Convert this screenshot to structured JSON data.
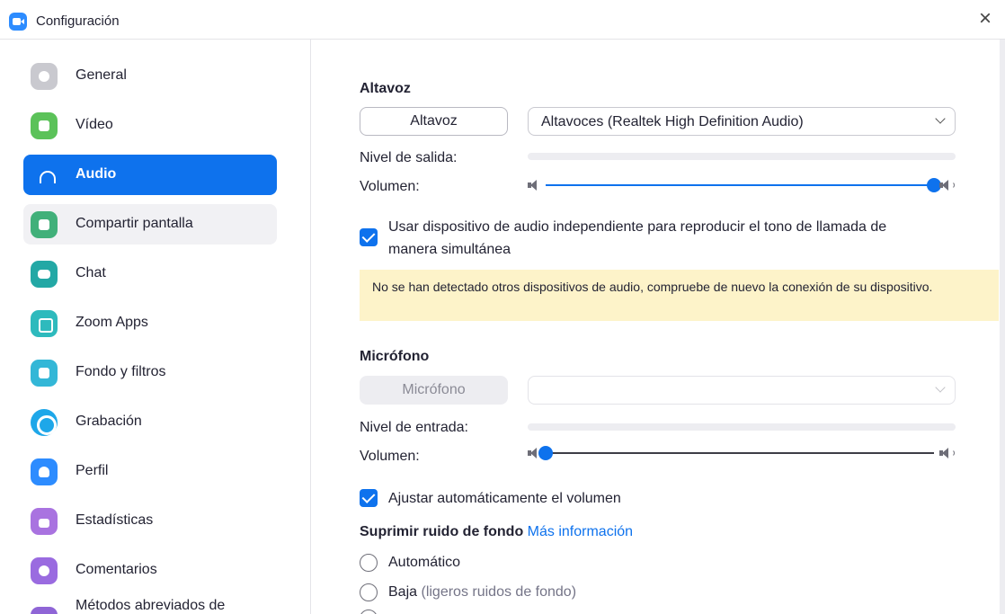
{
  "window": {
    "title": "Configuración",
    "close": "×"
  },
  "sidebar": {
    "items": [
      {
        "label": "General",
        "icon": "gear-icon"
      },
      {
        "label": "Vídeo",
        "icon": "video-camera-icon"
      },
      {
        "label": "Audio",
        "icon": "headphones-icon",
        "active": true
      },
      {
        "label": "Compartir pantalla",
        "icon": "share-screen-icon"
      },
      {
        "label": "Chat",
        "icon": "chat-bubble-icon"
      },
      {
        "label": "Zoom Apps",
        "icon": "apps-icon"
      },
      {
        "label": "Fondo y filtros",
        "icon": "background-person-icon"
      },
      {
        "label": "Grabación",
        "icon": "record-icon"
      },
      {
        "label": "Perfil",
        "icon": "profile-icon"
      },
      {
        "label": "Estadísticas",
        "icon": "bar-chart-icon"
      },
      {
        "label": "Comentarios",
        "icon": "smiley-icon"
      },
      {
        "label": "Métodos abreviados de",
        "icon": "keyboard-icon"
      }
    ]
  },
  "speaker": {
    "title": "Altavoz",
    "test_button": "Altavoz",
    "device": "Altavoces (Realtek High Definition Audio)",
    "output_level_label": "Nivel de salida:",
    "volume_label": "Volumen:",
    "volume_fraction": 1.0
  },
  "ringtone_option": {
    "checked": true,
    "label_line1": "Usar dispositivo de audio independiente para reproducir el tono de llamada de",
    "label_line2": "manera simultánea"
  },
  "notice": "No se han detectado otros dispositivos de audio, compruebe de nuevo la conexión de su dispositivo.",
  "microphone": {
    "title": "Micrófono",
    "test_button": "Micrófono",
    "device": "",
    "input_level_label": "Nivel de entrada:",
    "volume_label": "Volumen:",
    "volume_fraction": 0.0
  },
  "auto_volume": {
    "checked": true,
    "label": "Ajustar automáticamente el volumen"
  },
  "noise": {
    "title": "Suprimir ruido de fondo",
    "link": "Más información",
    "options": [
      {
        "label": "Automático",
        "note": ""
      },
      {
        "label": "Baja",
        "note": "(ligeros ruidos de fondo)"
      }
    ]
  },
  "colors": {
    "accent": "#0e72ed",
    "notice_bg": "#fdf3c9"
  }
}
